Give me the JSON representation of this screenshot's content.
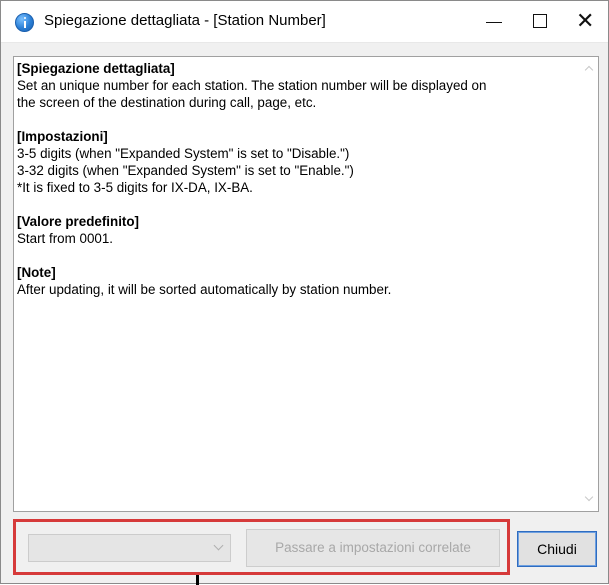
{
  "window": {
    "title": "Spiegazione dettagliata - [Station Number]",
    "controls": {
      "minimize": "minimize-icon",
      "maximize": "maximize-icon",
      "close_glyph": "✕"
    }
  },
  "content": {
    "sections": [
      {
        "heading": "[Spiegazione dettagliata]",
        "lines": [
          "Set an unique number for each station. The station number will be displayed on",
          "the  screen of the destination during call, page, etc."
        ]
      },
      {
        "heading": "[Impostazioni]",
        "lines": [
          "3-5 digits (when \"Expanded System\" is set to \"Disable.\")",
          "3-32 digits (when \"Expanded System\" is set to \"Enable.\")",
          "*It is fixed to 3-5 digits for IX-DA, IX-BA."
        ]
      },
      {
        "heading": "[Valore predefinito]",
        "lines": [
          "Start from 0001."
        ]
      },
      {
        "heading": "[Note]",
        "lines": [
          "After updating, it will be sorted automatically by station number."
        ]
      }
    ]
  },
  "footer": {
    "select_value": "",
    "related_button_label": "Passare a impostazioni correlate",
    "close_button_label": "Chiudi"
  },
  "colors": {
    "highlight": "#d63a3a",
    "focus_border": "#2f6cc0"
  }
}
